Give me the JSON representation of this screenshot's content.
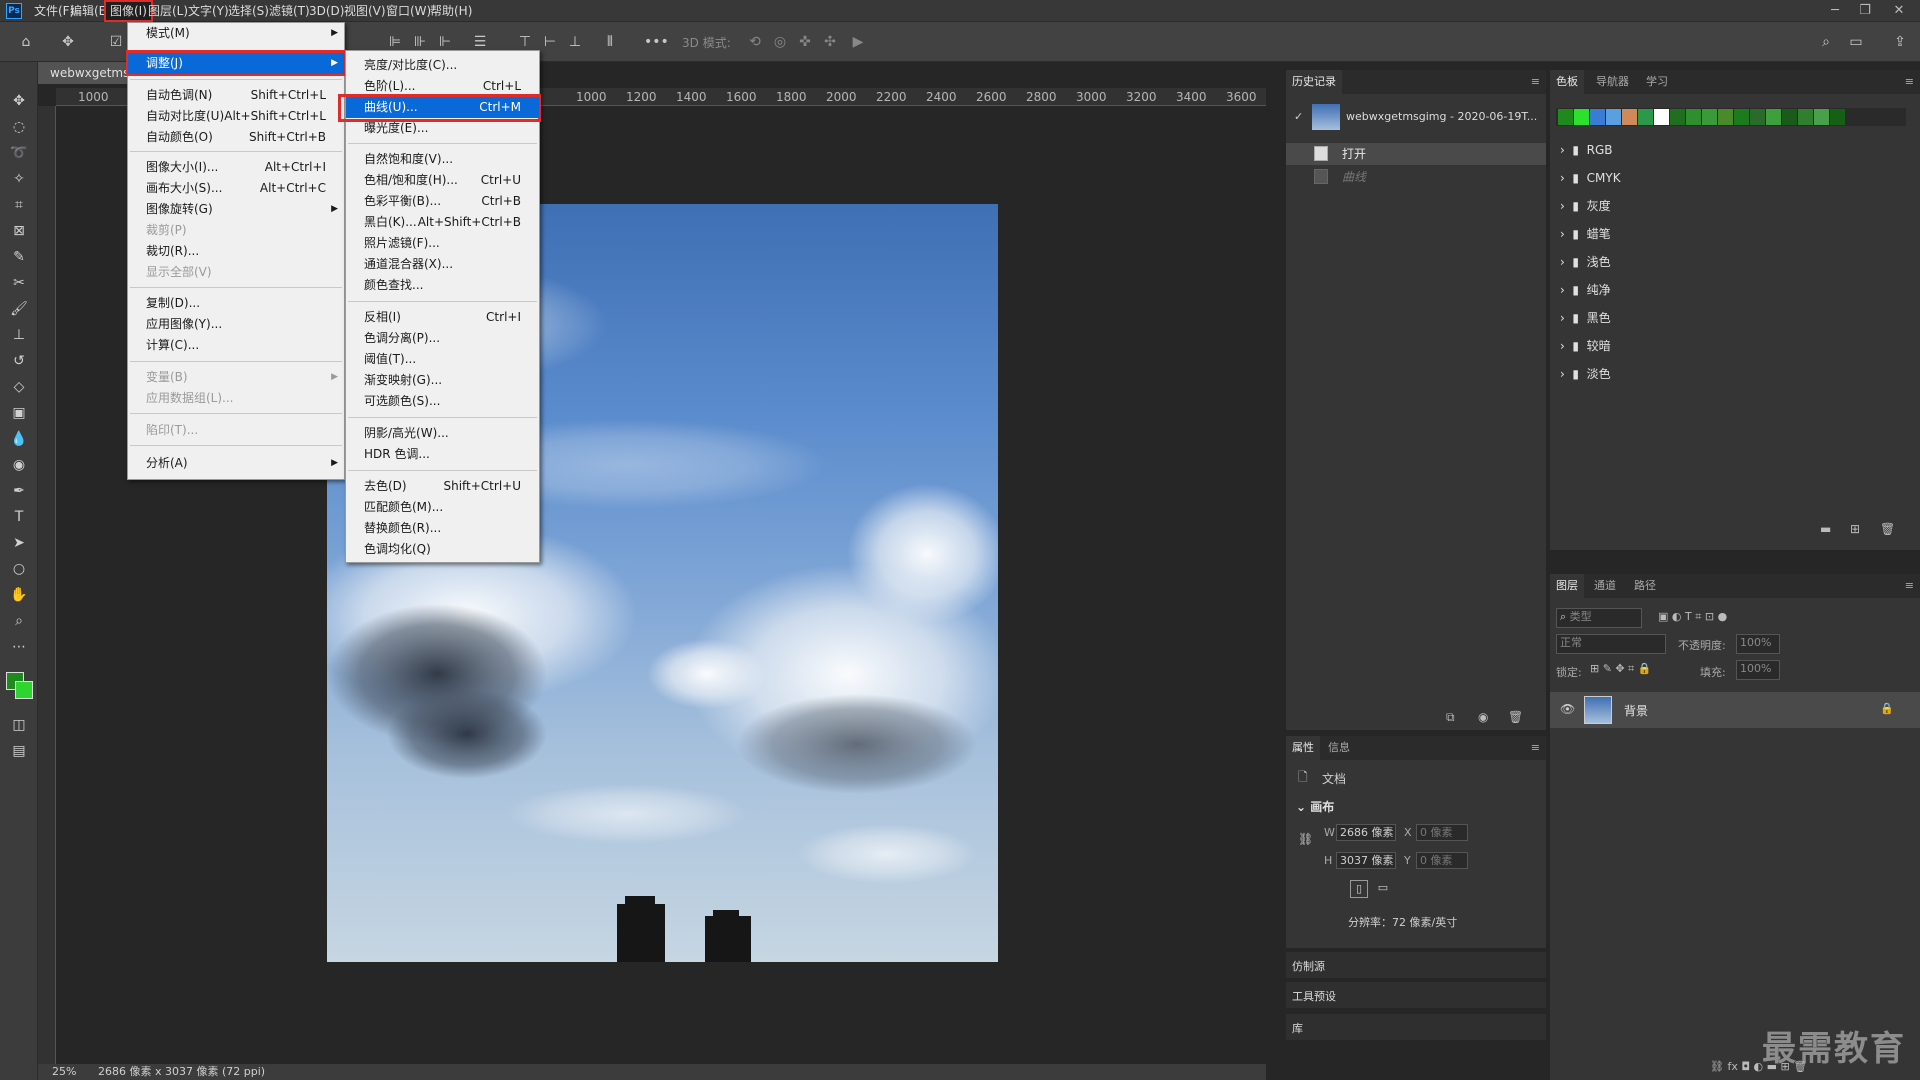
{
  "menubar": {
    "logo": "Ps",
    "items": [
      "文件(F)",
      "编辑(E)",
      "图像(I)",
      "图层(L)",
      "文字(Y)",
      "选择(S)",
      "滤镜(T)",
      "3D(D)",
      "视图(V)",
      "窗口(W)",
      "帮助(H)"
    ]
  },
  "options": {
    "mode3d": "3D 模式:"
  },
  "document": {
    "tab": "webwxgetmsg",
    "zoom": "25%",
    "info": "2686 像素 x 3037 像素 (72 ppi)",
    "ruler_h": [
      "1000",
      "1000",
      "1200",
      "1400",
      "1600",
      "1800",
      "2000",
      "2200",
      "2400",
      "2600",
      "2800",
      "3000",
      "3200",
      "3400",
      "3600"
    ]
  },
  "image_menu": {
    "items": [
      {
        "label": "模式(M)",
        "shortcut": "",
        "sub": true
      },
      {
        "label": "调整(J)",
        "shortcut": "",
        "sub": true
      },
      {
        "label": "自动色调(N)",
        "shortcut": "Shift+Ctrl+L"
      },
      {
        "label": "自动对比度(U)",
        "shortcut": "Alt+Shift+Ctrl+L"
      },
      {
        "label": "自动颜色(O)",
        "shortcut": "Shift+Ctrl+B"
      },
      {
        "label": "图像大小(I)...",
        "shortcut": "Alt+Ctrl+I"
      },
      {
        "label": "画布大小(S)...",
        "shortcut": "Alt+Ctrl+C"
      },
      {
        "label": "图像旋转(G)",
        "shortcut": "",
        "sub": true
      },
      {
        "label": "裁剪(P)",
        "shortcut": "",
        "disabled": true
      },
      {
        "label": "裁切(R)...",
        "shortcut": ""
      },
      {
        "label": "显示全部(V)",
        "shortcut": "",
        "disabled": true
      },
      {
        "label": "复制(D)...",
        "shortcut": ""
      },
      {
        "label": "应用图像(Y)...",
        "shortcut": ""
      },
      {
        "label": "计算(C)...",
        "shortcut": ""
      },
      {
        "label": "变量(B)",
        "shortcut": "",
        "sub": true,
        "disabled": true
      },
      {
        "label": "应用数据组(L)...",
        "shortcut": "",
        "disabled": true
      },
      {
        "label": "陷印(T)...",
        "shortcut": "",
        "disabled": true
      },
      {
        "label": "分析(A)",
        "shortcut": "",
        "sub": true
      }
    ]
  },
  "adjust_menu": {
    "items": [
      {
        "label": "亮度/对比度(C)...",
        "shortcut": ""
      },
      {
        "label": "色阶(L)...",
        "shortcut": "Ctrl+L"
      },
      {
        "label": "曲线(U)...",
        "shortcut": "Ctrl+M"
      },
      {
        "label": "曝光度(E)...",
        "shortcut": ""
      },
      {
        "label": "自然饱和度(V)...",
        "shortcut": ""
      },
      {
        "label": "色相/饱和度(H)...",
        "shortcut": "Ctrl+U"
      },
      {
        "label": "色彩平衡(B)...",
        "shortcut": "Ctrl+B"
      },
      {
        "label": "黑白(K)...",
        "shortcut": "Alt+Shift+Ctrl+B"
      },
      {
        "label": "照片滤镜(F)...",
        "shortcut": ""
      },
      {
        "label": "通道混合器(X)...",
        "shortcut": ""
      },
      {
        "label": "颜色查找...",
        "shortcut": ""
      },
      {
        "label": "反相(I)",
        "shortcut": "Ctrl+I"
      },
      {
        "label": "色调分离(P)...",
        "shortcut": ""
      },
      {
        "label": "阈值(T)...",
        "shortcut": ""
      },
      {
        "label": "渐变映射(G)...",
        "shortcut": ""
      },
      {
        "label": "可选颜色(S)...",
        "shortcut": ""
      },
      {
        "label": "阴影/高光(W)...",
        "shortcut": ""
      },
      {
        "label": "HDR 色调...",
        "shortcut": ""
      },
      {
        "label": "去色(D)",
        "shortcut": "Shift+Ctrl+U"
      },
      {
        "label": "匹配颜色(M)...",
        "shortcut": ""
      },
      {
        "label": "替换颜色(R)...",
        "shortcut": ""
      },
      {
        "label": "色调均化(Q)",
        "shortcut": ""
      }
    ]
  },
  "history": {
    "tab": "历史记录",
    "snapshot": "webwxgetmsgimg - 2020-06-19T...",
    "steps": [
      "打开",
      "曲线"
    ]
  },
  "swatches": {
    "tabs": [
      "色板",
      "导航器",
      "学习"
    ],
    "colors": [
      "#1e8a1e",
      "#2ee02e",
      "#3a7bd5",
      "#5aa0e0",
      "#d08a5a",
      "#2a9a4a",
      "#ffffff",
      "#1f6f1f",
      "#2f8f2f",
      "#3a9a3a",
      "#4a8a2a",
      "#1e7a1e",
      "#2a6a2a",
      "#3f9f3f",
      "#1a5a1a",
      "#2f7f2f",
      "#4aa04a",
      "#156015"
    ],
    "folders": [
      "RGB",
      "CMYK",
      "灰度",
      "蜡笔",
      "浅色",
      "纯净",
      "黑色",
      "较暗",
      "淡色"
    ]
  },
  "layers": {
    "tabs": [
      "图层",
      "通道",
      "路径"
    ],
    "kind": "类型",
    "blend": "正常",
    "opacity_label": "不透明度:",
    "opacity": "100%",
    "lock_label": "锁定:",
    "fill_label": "填充:",
    "fill": "100%",
    "layer_name": "背景"
  },
  "properties": {
    "tabs": [
      "属性",
      "信息"
    ],
    "doc": "文档",
    "section": "画布",
    "w_label": "W",
    "w": "2686 像素",
    "h_label": "H",
    "h": "3037 像素",
    "x_label": "X",
    "x": "0 像素",
    "y_label": "Y",
    "y": "0 像素",
    "resolution": "分辨率：72 像素/英寸"
  },
  "collapsed": [
    "仿制源",
    "工具预设",
    "库"
  ],
  "watermark": "最需教育"
}
